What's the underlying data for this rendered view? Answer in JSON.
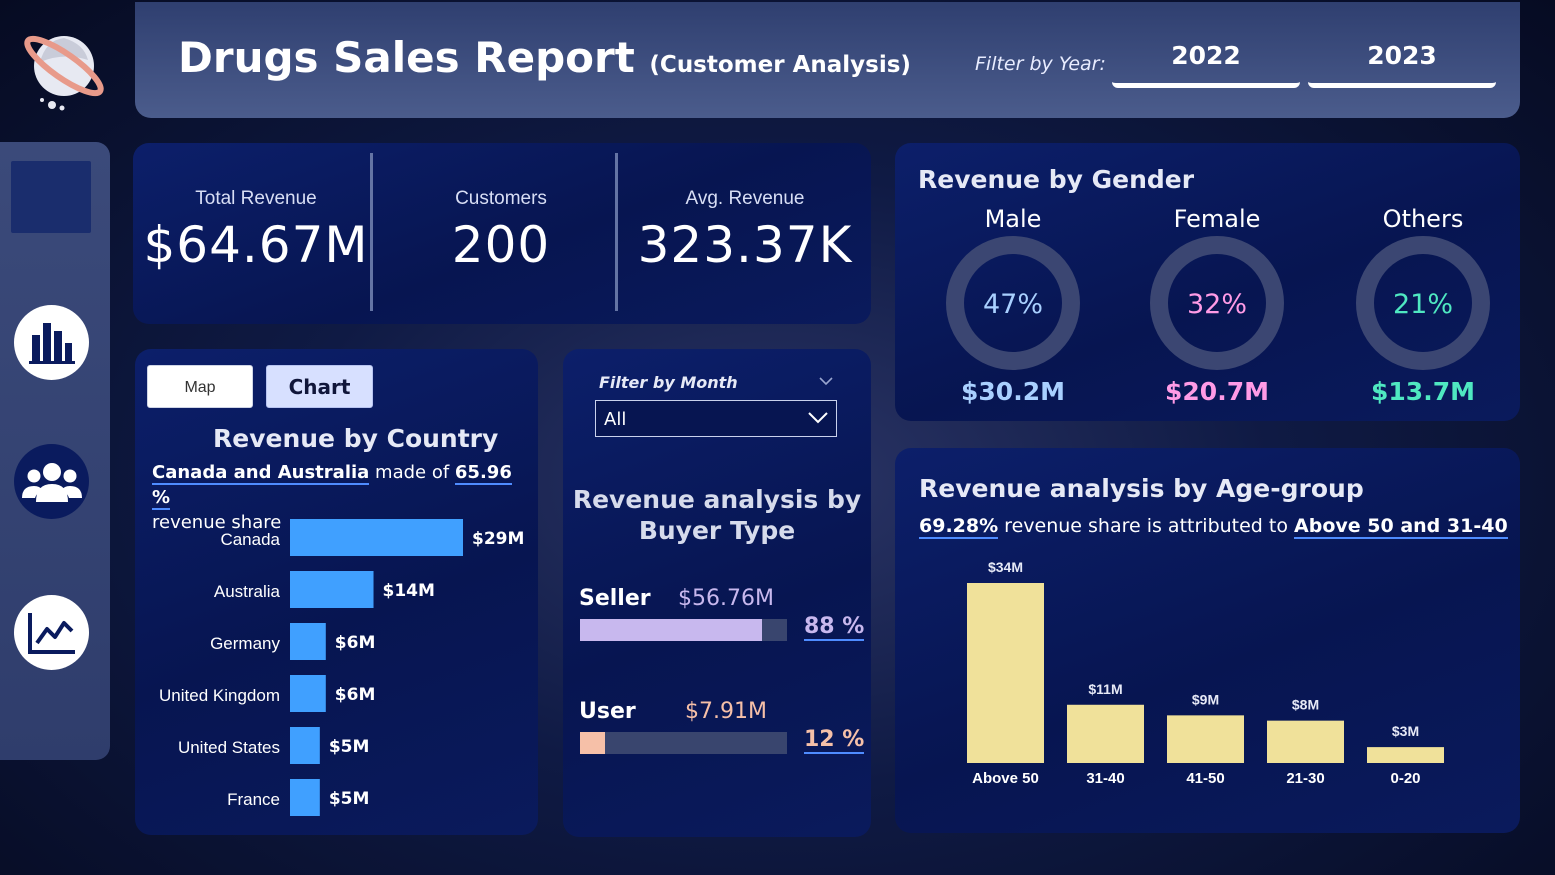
{
  "header": {
    "title": "Drugs Sales Report",
    "subtitle": "(Customer Analysis)",
    "filter_label": "Filter by Year:",
    "years": [
      "2022",
      "2023"
    ]
  },
  "kpis": [
    {
      "label": "Total Revenue",
      "value": "$64.67M"
    },
    {
      "label": "Customers",
      "value": "200"
    },
    {
      "label": "Avg. Revenue",
      "value": "323.37K"
    }
  ],
  "gender": {
    "title": "Revenue by Gender",
    "items": [
      {
        "name": "Male",
        "percent_label": "47%",
        "share": 0.47,
        "amount": "$30.2M",
        "color": "#a9d0ff"
      },
      {
        "name": "Female",
        "percent_label": "32%",
        "share": 0.32,
        "amount": "$20.7M",
        "color": "#ff9be6"
      },
      {
        "name": "Others",
        "percent_label": "21%",
        "share": 0.21,
        "amount": "$13.7M",
        "color": "#4fe8c1"
      }
    ],
    "track_color": "#3b4672"
  },
  "country": {
    "tabs": {
      "map": "Map",
      "chart": "Chart"
    },
    "title": "Revenue by Country",
    "insight": {
      "highlight": "Canada and Australia",
      "mid": " made of ",
      "pct": "65.96 %",
      "tail": "revenue share"
    },
    "bar_color": "#40a0ff"
  },
  "buyer": {
    "filter_label": "Filter by Month",
    "filter_value": "All",
    "title_line1": "Revenue analysis by",
    "title_line2": "Buyer Type",
    "types": [
      {
        "name": "Seller",
        "amount": "$56.76M",
        "pct": "88 %",
        "share": 0.88,
        "color": "#c8b8ee",
        "text_color": "#c8b8ee"
      },
      {
        "name": "User",
        "amount": "$7.91M",
        "pct": "12 %",
        "share": 0.12,
        "color": "#f6c0a8",
        "text_color": "#f6c0a8"
      }
    ]
  },
  "age": {
    "title": "Revenue analysis by Age-group",
    "insight": {
      "pct": "69.28%",
      "mid": " revenue share is attributed to ",
      "groups": "Above 50 and 31-40"
    },
    "bar_color": "#f0e19a"
  },
  "chart_data": [
    {
      "type": "bar",
      "orientation": "horizontal",
      "title": "Revenue by Country",
      "categories": [
        "Canada",
        "Australia",
        "Germany",
        "United Kingdom",
        "United States",
        "France"
      ],
      "values": [
        29,
        14,
        6,
        6,
        5,
        5
      ],
      "value_labels": [
        "$29M",
        "$14M",
        "$6M",
        "$6M",
        "$5M",
        "$5M"
      ],
      "unit": "$M"
    },
    {
      "type": "bar",
      "title": "Revenue analysis by Age-group",
      "categories": [
        "Above 50",
        "31-40",
        "41-50",
        "21-30",
        "0-20"
      ],
      "values": [
        34,
        11,
        9,
        8,
        3
      ],
      "value_labels": [
        "$34M",
        "$11M",
        "$9M",
        "$8M",
        "$3M"
      ],
      "unit": "$M"
    }
  ]
}
